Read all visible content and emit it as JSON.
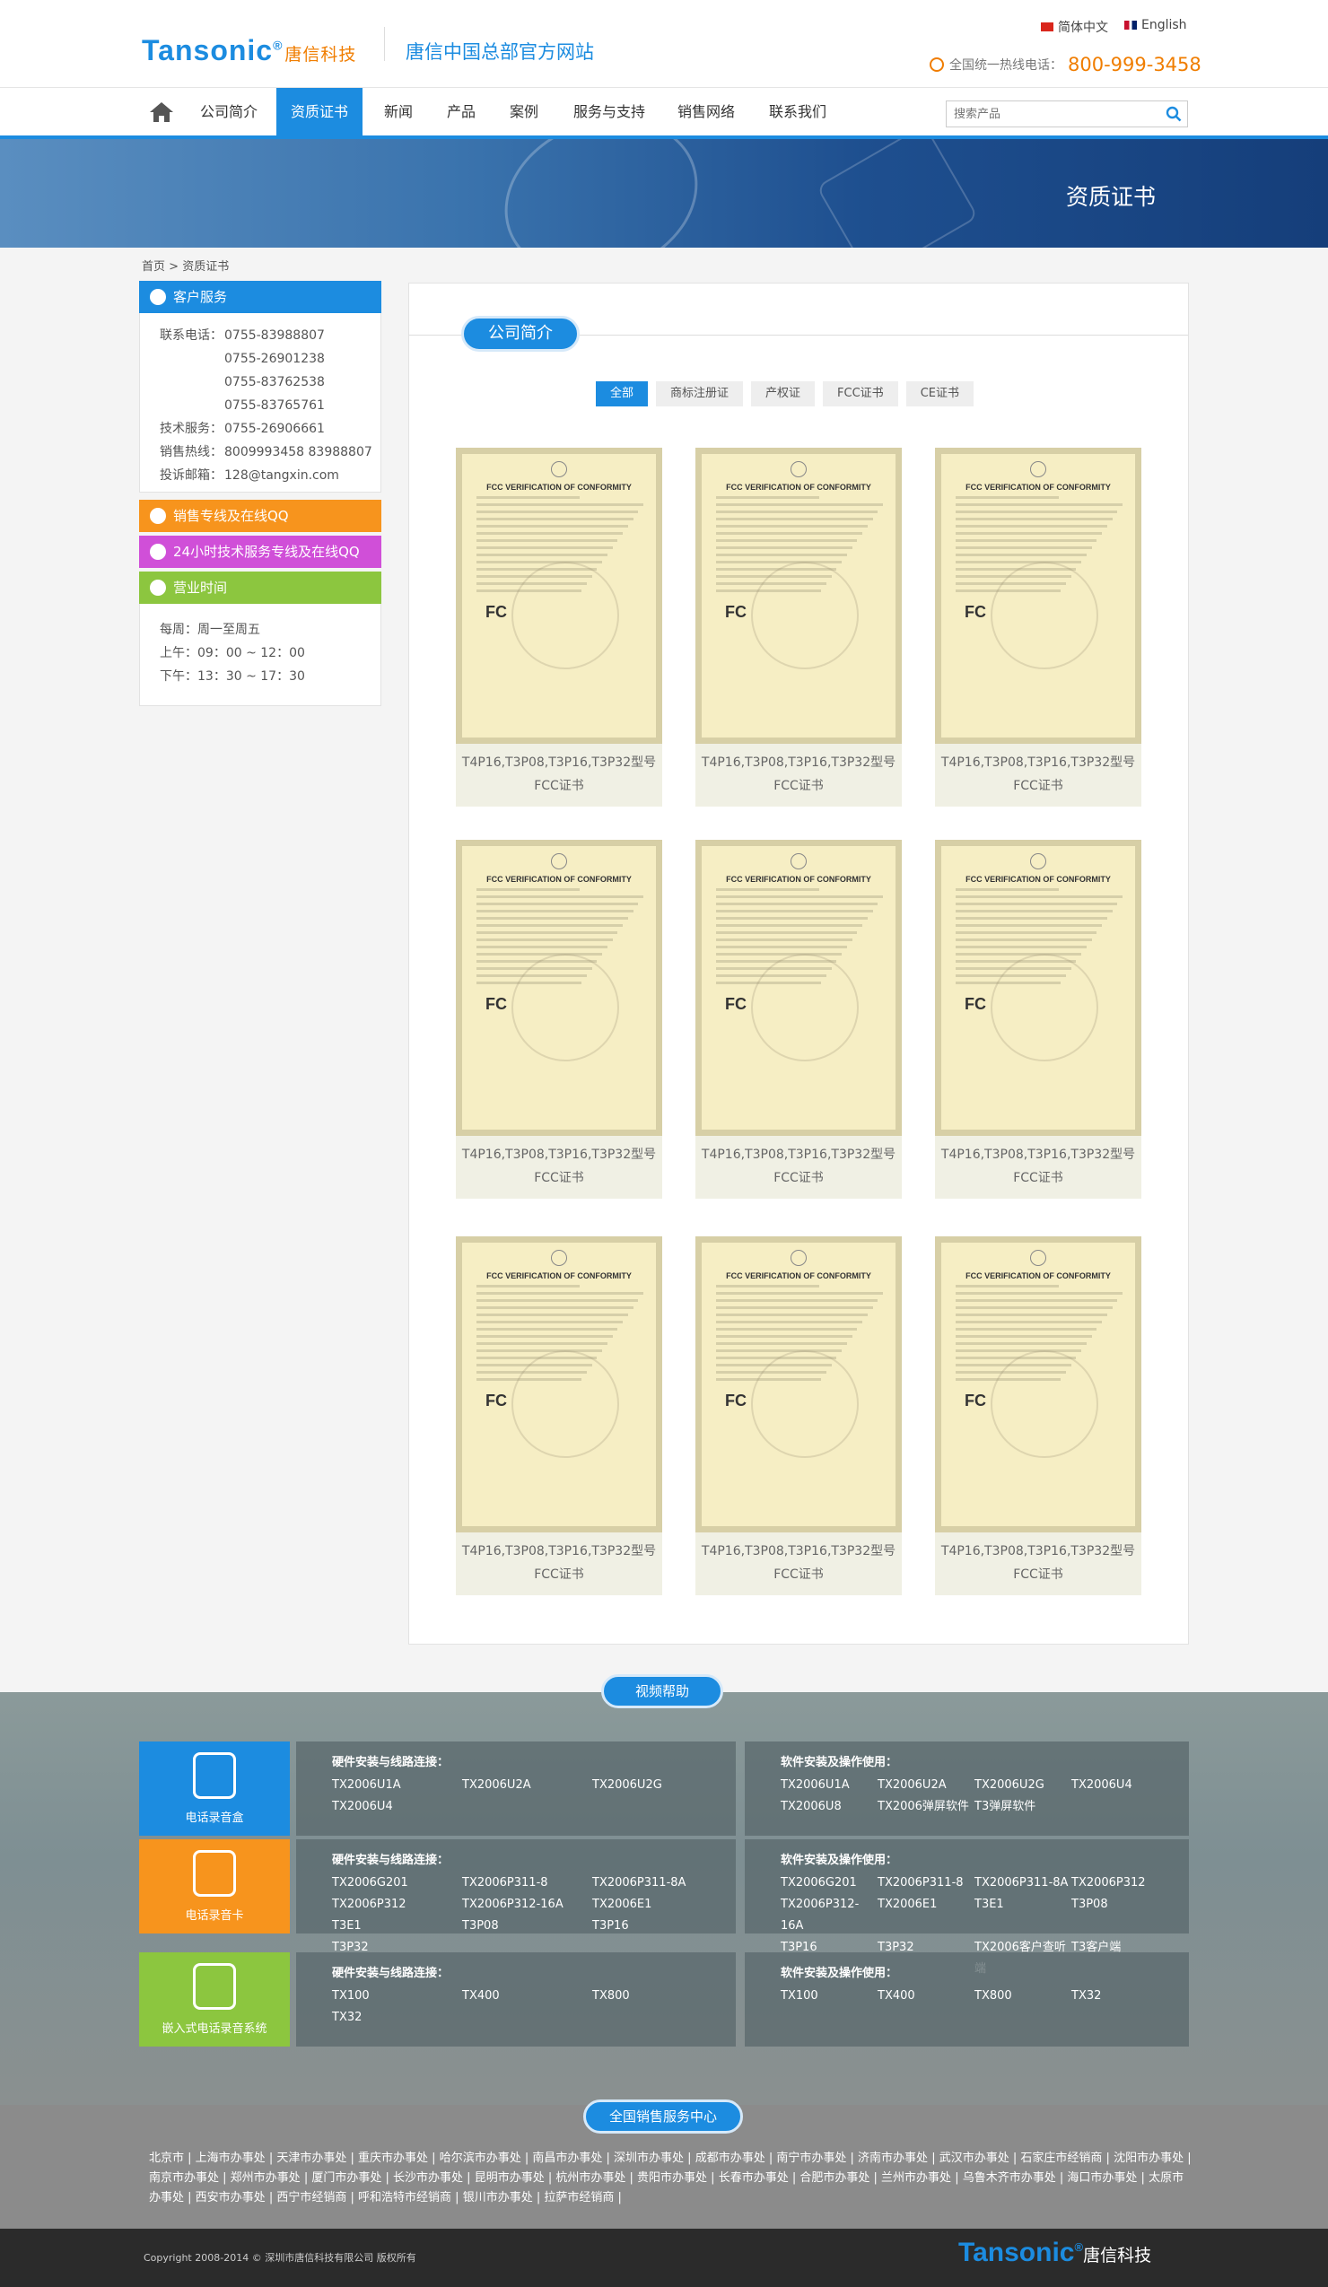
{
  "header": {
    "logo_en": "Tansonic",
    "logo_reg": "®",
    "logo_cn": "唐信科技",
    "site_name": "唐信中国总部官方网站",
    "lang_cn": "简体中文",
    "lang_en": "English",
    "hotline_label": "全国统一热线电话：",
    "hotline_number": "800-999-3458"
  },
  "nav": {
    "items": [
      "公司简介",
      "资质证书",
      "新闻",
      "产品",
      "案例",
      "服务与支持",
      "销售网络",
      "联系我们"
    ],
    "active": "资质证书",
    "search_placeholder": "搜索产品"
  },
  "banner": {
    "title": "资质证书"
  },
  "breadcrumb": {
    "home": "首页",
    "sep": ">",
    "current": "资质证书"
  },
  "sidebar": {
    "service_title": "客户服务",
    "phone_label": "联系电话：",
    "phones": [
      "0755-83988807",
      "0755-26901238",
      "0755-83762538",
      "0755-83765761"
    ],
    "tech_label": "技术服务：",
    "tech_phone": "0755-26906661",
    "sales_label": "销售热线：",
    "sales_phone": "8009993458 83988807",
    "complaint_label": "投诉邮箱：",
    "complaint_email": "128@tangxin.com",
    "sales_qq": "销售专线及在线QQ",
    "tech_qq": "24小时技术服务专线及在线QQ",
    "hours_title": "营业时间",
    "hours": [
      "每周：周一至周五",
      "上午：09：00 ~ 12：00",
      "下午：13：30 ~ 17：30"
    ]
  },
  "main": {
    "section_title": "公司简介",
    "filters": [
      "全部",
      "商标注册证",
      "产权证",
      "FCC证书",
      "CE证书"
    ],
    "active_filter": "全部",
    "cert_heading": "FCC VERIFICATION OF CONFORMITY",
    "cert_mark": "FC",
    "certs": [
      {
        "line1": "T4P16,T3P08,T3P16,T3P32型号",
        "line2": "FCC证书"
      },
      {
        "line1": "T4P16,T3P08,T3P16,T3P32型号",
        "line2": "FCC证书"
      },
      {
        "line1": "T4P16,T3P08,T3P16,T3P32型号",
        "line2": "FCC证书"
      },
      {
        "line1": "T4P16,T3P08,T3P16,T3P32型号",
        "line2": "FCC证书"
      },
      {
        "line1": "T4P16,T3P08,T3P16,T3P32型号",
        "line2": "FCC证书"
      },
      {
        "line1": "T4P16,T3P08,T3P16,T3P32型号",
        "line2": "FCC证书"
      },
      {
        "line1": "T4P16,T3P08,T3P16,T3P32型号",
        "line2": "FCC证书"
      },
      {
        "line1": "T4P16,T3P08,T3P16,T3P32型号",
        "line2": "FCC证书"
      },
      {
        "line1": "T4P16,T3P08,T3P16,T3P32型号",
        "line2": "FCC证书"
      }
    ]
  },
  "video_help": {
    "title": "视频帮助",
    "rows": [
      {
        "name": "电话录音盒",
        "color": "#1c8ce0",
        "hw_title": "硬件安装与线路连接：",
        "hw": [
          "TX2006U1A",
          "TX2006U2A",
          "TX2006U2G",
          "TX2006U4"
        ],
        "sw_title": "软件安装及操作使用：",
        "sw": [
          "TX2006U1A",
          "TX2006U2A",
          "TX2006U2G",
          "TX2006U4",
          "TX2006U8",
          "TX2006弹屏软件",
          "T3弹屏软件"
        ]
      },
      {
        "name": "电话录音卡",
        "color": "#f7941d",
        "hw_title": "硬件安装与线路连接：",
        "hw": [
          "TX2006G201",
          "TX2006P311-8",
          "TX2006P311-8A",
          "TX2006P312",
          "TX2006P312-16A",
          "TX2006E1",
          "T3E1",
          "T3P08",
          "T3P16",
          "T3P32"
        ],
        "sw_title": "软件安装及操作使用：",
        "sw": [
          "TX2006G201",
          "TX2006P311-8",
          "TX2006P311-8A",
          "TX2006P312",
          "TX2006P312-16A",
          "TX2006E1",
          "T3E1",
          "T3P08",
          "T3P16",
          "T3P32",
          "TX2006客户查听端",
          "T3客户端"
        ]
      },
      {
        "name": "嵌入式电话录音系统",
        "color": "#8cc63f",
        "hw_title": "硬件安装与线路连接：",
        "hw": [
          "TX100",
          "TX400",
          "TX800",
          "TX32"
        ],
        "sw_title": "软件安装及操作使用：",
        "sw": [
          "TX100",
          "TX400",
          "TX800",
          "TX32"
        ]
      }
    ]
  },
  "offices": {
    "title": "全国销售服务中心",
    "list": [
      "北京市",
      "上海市办事处",
      "天津市办事处",
      "重庆市办事处",
      "哈尔滨市办事处",
      "南昌市办事处",
      "深圳市办事处",
      "成都市办事处",
      "南宁市办事处",
      "济南市办事处",
      "武汉市办事处",
      "石家庄市经销商",
      "沈阳市办事处",
      "南京市办事处",
      "郑州市办事处",
      "厦门市办事处",
      "长沙市办事处",
      "昆明市办事处",
      "杭州市办事处",
      "贵阳市办事处",
      "长春市办事处",
      "合肥市办事处",
      "兰州市办事处",
      "乌鲁木齐市办事处",
      "海口市办事处",
      "太原市办事处",
      "西安市办事处",
      "西宁市经销商",
      "呼和浩特市经销商",
      "银川市办事处",
      "拉萨市经销商"
    ]
  },
  "footer": {
    "copyright": "Copyright 2008-2014 © 深圳市唐信科技有限公司 版权所有",
    "logo_en": "Tansonic",
    "logo_reg": "®",
    "logo_cn": "唐信科技"
  }
}
